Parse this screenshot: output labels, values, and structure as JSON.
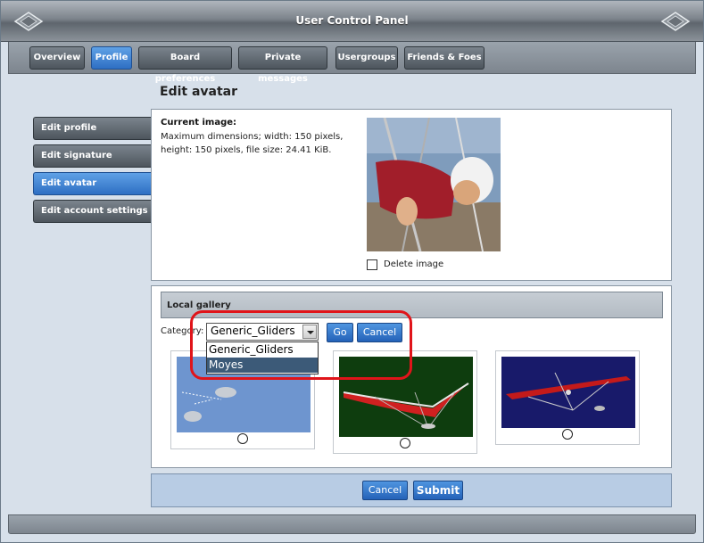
{
  "window": {
    "title": "User Control Panel"
  },
  "tabs": [
    {
      "label": "Overview"
    },
    {
      "label": "Profile"
    },
    {
      "label": "Board preferences"
    },
    {
      "label": "Private messages"
    },
    {
      "label": "Usergroups"
    },
    {
      "label": "Friends & Foes"
    }
  ],
  "page": {
    "title": "Edit avatar"
  },
  "sidenav": [
    {
      "label": "Edit profile"
    },
    {
      "label": "Edit signature"
    },
    {
      "label": "Edit avatar"
    },
    {
      "label": "Edit account settings"
    }
  ],
  "current": {
    "label": "Current image:",
    "desc": "Maximum dimensions; width: 150 pixels, height: 150 pixels, file size: 24.41 KiB.",
    "delete_label": "Delete image"
  },
  "gallery": {
    "header": "Local gallery",
    "category_label": "Category:",
    "selected": "Generic_Gliders",
    "options": [
      "Generic_Gliders",
      "Moyes"
    ],
    "go": "Go",
    "cancel": "Cancel"
  },
  "footer": {
    "cancel": "Cancel",
    "submit": "Submit"
  },
  "colors": {
    "accent": "#2e6fc3",
    "highlight": "#e0141a"
  }
}
